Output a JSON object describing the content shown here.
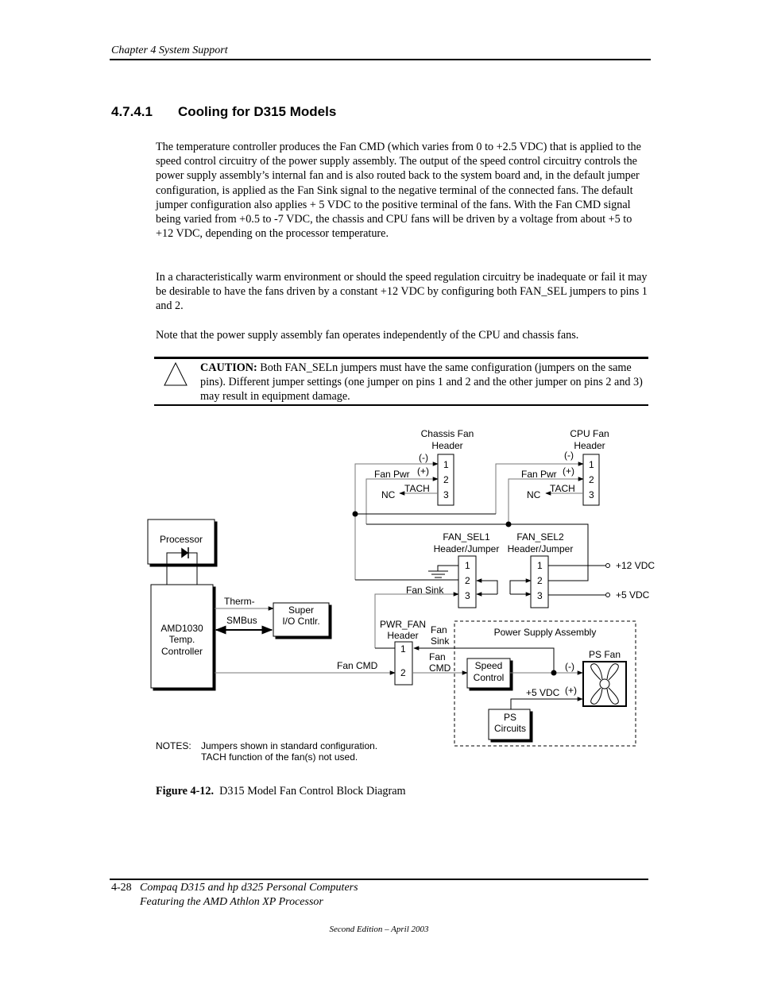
{
  "header": {
    "running_title": "Chapter 4  System Support"
  },
  "section": {
    "number": "4.7.4.1",
    "title": "Cooling for D315 Models"
  },
  "body": {
    "paragraphs": [
      "The temperature controller produces the Fan CMD (which varies from 0 to +2.5 VDC) that is applied to the speed control circuitry of the power supply assembly. The output of the speed control circuitry controls the power supply assembly’s internal fan and is also routed back to the system board and, in the default jumper configuration, is applied as the Fan Sink signal to the negative terminal of the connected fans. The default jumper configuration also applies + 5 VDC to the positive terminal of the fans. With the Fan CMD signal being varied from +0.5 to -7 VDC, the chassis and CPU fans will be driven by a voltage from about +5 to +12 VDC, depending on the processor temperature.",
      "In a characteristically warm environment or should the speed regulation circuitry be inadequate or fail it may be desirable to have the fans driven by a constant +12 VDC by configuring both FAN_SEL jumpers to pins 1 and 2.",
      "Note that the power supply assembly fan operates independently of the CPU and chassis fans."
    ]
  },
  "caution": {
    "icon": "warning-triangle-icon",
    "label": "CAUTION:",
    "text": " Both FAN_SELn jumpers must have the same configuration (jumpers on the same pins). Different jumper settings (one jumper on pins 1 and 2 and the other jumper on pins 2 and 3) may result in equipment damage."
  },
  "diagram": {
    "chassis_fan_header": {
      "title_1": "Chassis Fan",
      "title_2": "Header",
      "pins": [
        "1",
        "2",
        "3"
      ],
      "minus": "(-)",
      "plus": "(+)",
      "fan_pwr": "Fan Pwr",
      "tach": "TACH",
      "nc": "NC"
    },
    "cpu_fan_header": {
      "title_1": "CPU Fan",
      "title_2": "Header",
      "pins": [
        "1",
        "2",
        "3"
      ],
      "minus": "(-)",
      "plus": "(+)",
      "fan_pwr": "Fan Pwr",
      "tach": "TACH",
      "nc": "NC"
    },
    "fan_sel1": {
      "title_1": "FAN_SEL1",
      "title_2": "Header/Jumper",
      "pins": [
        "1",
        "2",
        "3"
      ]
    },
    "fan_sel2": {
      "title_1": "FAN_SEL2",
      "title_2": "Header/Jumper",
      "pins": [
        "1",
        "2",
        "3"
      ]
    },
    "rails": {
      "v12": "+12 VDC",
      "v5": "+5 VDC"
    },
    "processor": "Processor",
    "temp_controller": [
      "AMD1030",
      "Temp.",
      "Controller"
    ],
    "super_io": [
      "Super",
      "I/O Cntlr."
    ],
    "therm_label": "Therm-",
    "smbus_label": "SMBus",
    "fan_sink_label": "Fan Sink",
    "fan_cmd_label": "Fan CMD",
    "pwr_fan_header": {
      "title_1": "PWR_FAN",
      "title_2": "Header",
      "pins": [
        "1",
        "2"
      ]
    },
    "fan_sink_short": [
      "Fan",
      "Sink"
    ],
    "fan_cmd_short": [
      "Fan",
      "CMD"
    ],
    "power_supply_assembly": "Power Supply Assembly",
    "speed_control": [
      "Speed",
      "Control"
    ],
    "ps_fan": {
      "title": "PS Fan",
      "minus": "(-)",
      "plus": "(+)"
    },
    "ps_5vdc": "+5 VDC",
    "ps_circuits": [
      "PS",
      "Circuits"
    ],
    "notes_label": "NOTES:",
    "notes": [
      "Jumpers shown in standard configuration.",
      "TACH function of the fan(s) not used."
    ]
  },
  "figure": {
    "label": "Figure 4-12.",
    "caption": "  D315 Model Fan Control Block Diagram"
  },
  "footer": {
    "page_number": "4-28",
    "title_line_1": "Compaq D315 and hp d325 Personal Computers",
    "title_line_2": "Featuring the AMD Athlon XP Processor",
    "edition": "Second Edition – April 2003"
  }
}
